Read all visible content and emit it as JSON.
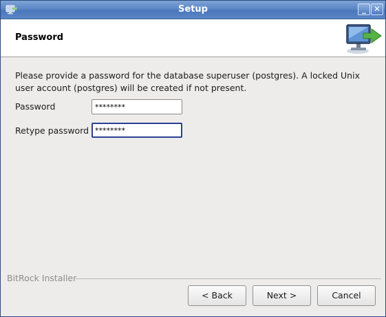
{
  "window": {
    "title": "Setup",
    "minimize_glyph": "_",
    "close_glyph": "✕"
  },
  "header": {
    "title": "Password",
    "icon": "installer-monitor-arrow-icon"
  },
  "content": {
    "description": "Please provide a password for the database superuser (postgres). A locked Unix user account (postgres) will be created if not present.",
    "password_label": "Password",
    "password_value": "********",
    "retype_label": "Retype password",
    "retype_value": "********"
  },
  "footer": {
    "brand": "BitRock Installer",
    "back_label": "< Back",
    "next_label": "Next >",
    "cancel_label": "Cancel"
  },
  "colors": {
    "titlebar": "#5c87c6",
    "window_bg": "#edeceb",
    "focus_border": "#2b3f8f"
  }
}
